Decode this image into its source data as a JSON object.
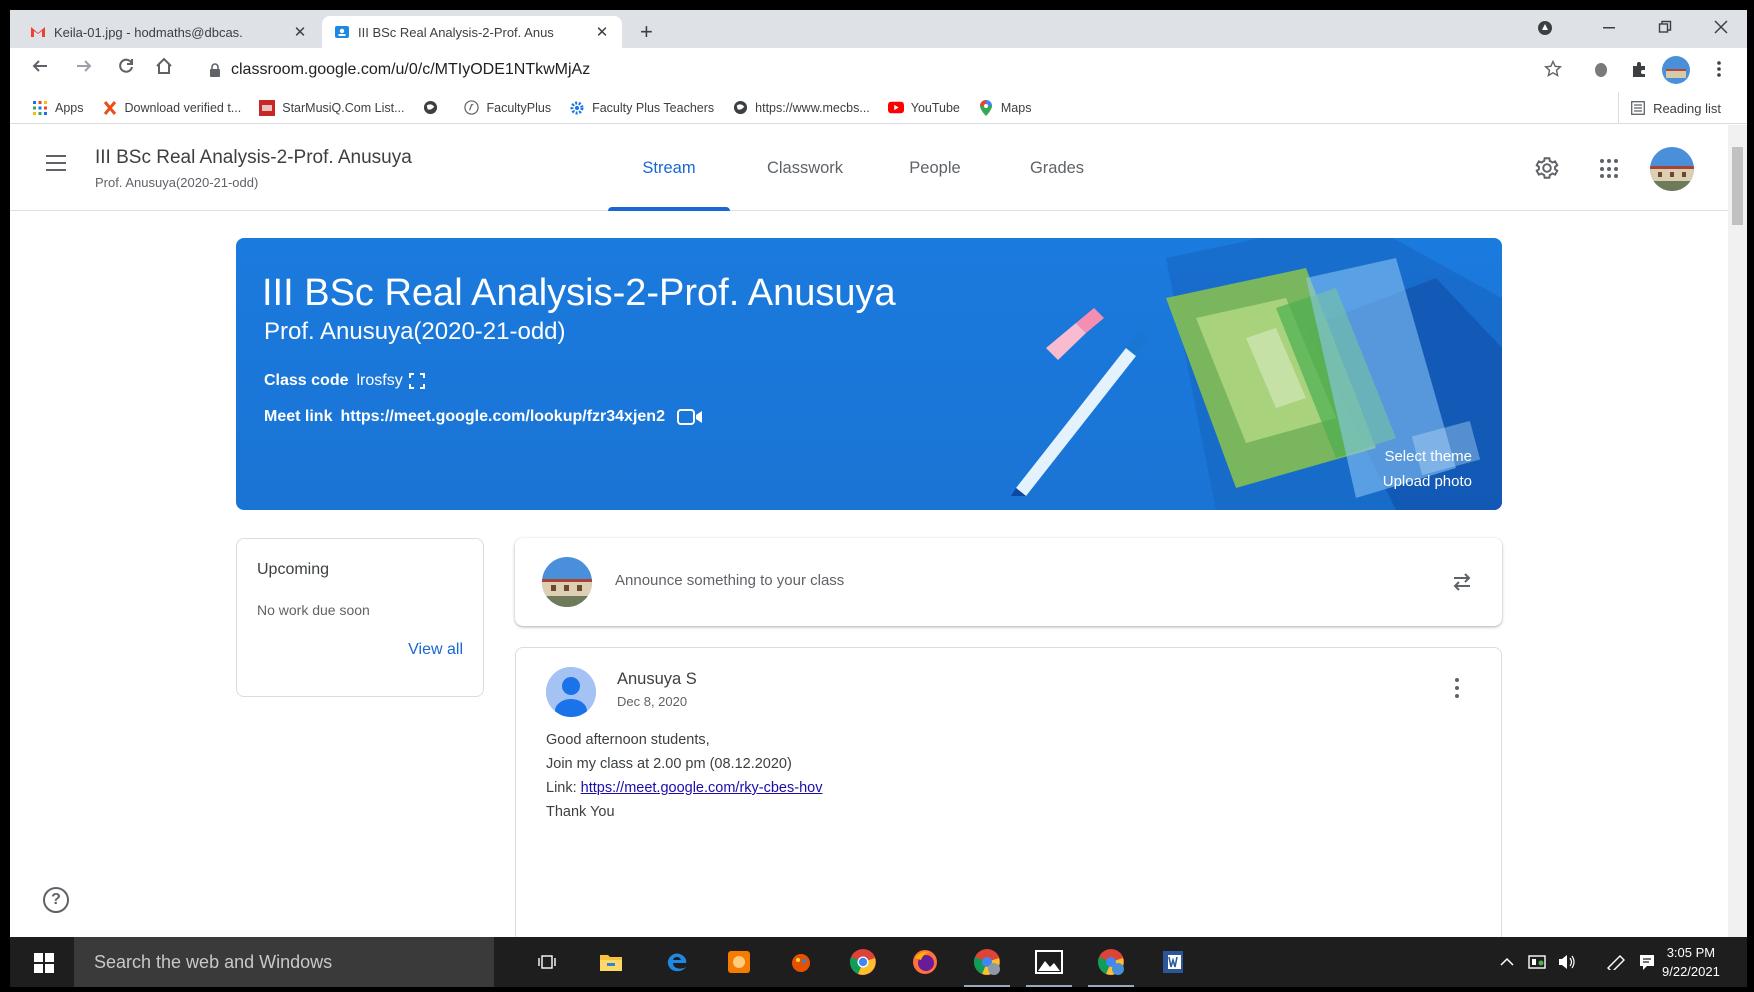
{
  "browser": {
    "tabs": [
      {
        "title": "Keila-01.jpg - hodmaths@dbcas.",
        "active": false
      },
      {
        "title": "III BSc Real Analysis-2-Prof. Anus",
        "active": true
      }
    ],
    "new_tab": "+",
    "close_glyph": "✕",
    "url": "classroom.google.com/u/0/c/MTIyODE1NTkwMjAz",
    "bookmarks": [
      {
        "label": "Apps",
        "icon": "apps-grid-icon"
      },
      {
        "label": "Download verified t...",
        "icon": "x-icon"
      },
      {
        "label": "StarMusiQ.Com List...",
        "icon": "starmusiq-icon"
      },
      {
        "label": "",
        "icon": "globe-icon"
      },
      {
        "label": "FacultyPlus",
        "icon": "facultyplus-icon"
      },
      {
        "label": "Faculty Plus Teachers",
        "icon": "gear-bookmark-icon"
      },
      {
        "label": "https://www.mecbs...",
        "icon": "globe-icon"
      },
      {
        "label": "YouTube",
        "icon": "youtube-icon"
      },
      {
        "label": "Maps",
        "icon": "maps-pin-icon"
      }
    ],
    "reading_list": "Reading list"
  },
  "header": {
    "title": "III BSc Real Analysis-2-Prof. Anusuya",
    "subtitle": "Prof. Anusuya(2020-21-odd)",
    "tabs": [
      {
        "label": "Stream",
        "active": true
      },
      {
        "label": "Classwork",
        "active": false
      },
      {
        "label": "People",
        "active": false
      },
      {
        "label": "Grades",
        "active": false
      }
    ]
  },
  "banner": {
    "title": "III BSc Real Analysis-2-Prof. Anusuya",
    "subtitle": "Prof. Anusuya(2020-21-odd)",
    "class_code_label": "Class code",
    "class_code": "lrosfsy",
    "meet_link_label": "Meet link",
    "meet_link": "https://meet.google.com/lookup/fzr34xjen2",
    "select_theme": "Select theme",
    "upload_photo": "Upload photo",
    "color": "#1a73e8"
  },
  "upcoming": {
    "title": "Upcoming",
    "empty_text": "No work due soon",
    "view_all": "View all"
  },
  "announce": {
    "placeholder": "Announce something to your class"
  },
  "post": {
    "author": "Anusuya S",
    "date": "Dec 8, 2020",
    "lines": [
      "Good afternoon students,",
      "Join my class at 2.00 pm (08.12.2020)"
    ],
    "link_prefix": "Link: ",
    "link": "https://meet.google.com/rky-cbes-hov",
    "closing": "Thank You"
  },
  "help": "?",
  "taskbar": {
    "search_placeholder": "Search the web and Windows",
    "time": "3:05 PM",
    "date": "9/22/2021"
  }
}
